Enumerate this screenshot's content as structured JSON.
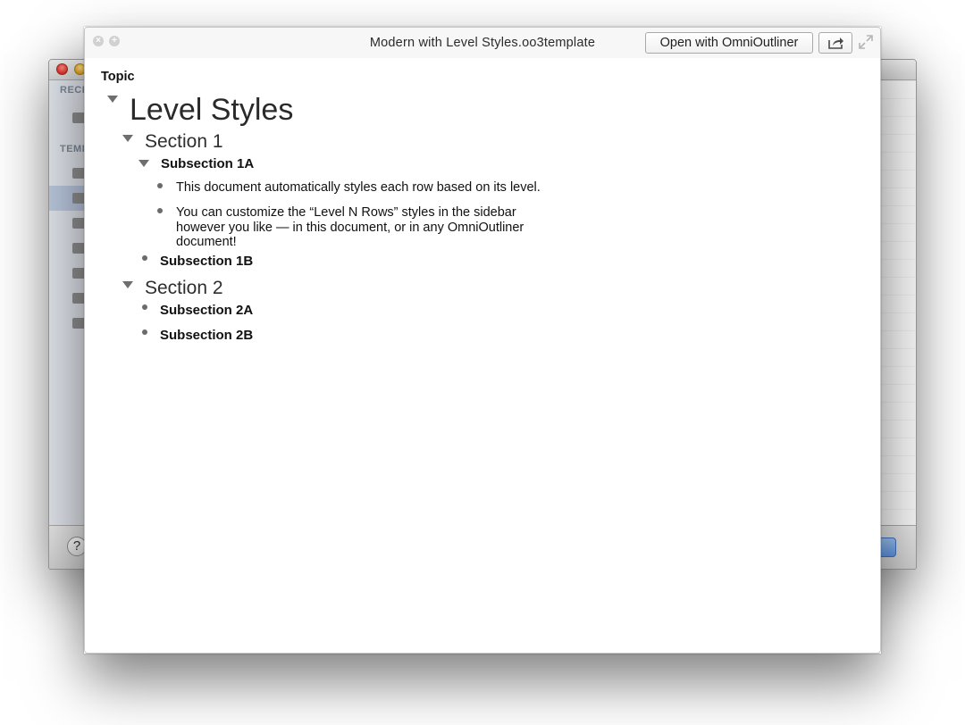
{
  "background_window": {
    "sidebar": {
      "recent_header": "RECE",
      "templates_header": "TEMP"
    },
    "help_label": "?"
  },
  "quicklook": {
    "title": "Modern with Level Styles.oo3template",
    "open_button_label": "Open with OmniOutliner",
    "close_glyph": "×",
    "zoom_glyph": "+"
  },
  "outline": {
    "column_header": "Topic",
    "level1_title": "Level Styles",
    "section1": {
      "title": "Section 1",
      "subsection_a": {
        "title": "Subsection 1A",
        "items": [
          "This document automatically styles each row based on its level.",
          "You can customize the “Level N Rows” styles in the sidebar however you like — in this document, or in any OmniOutliner document!"
        ]
      },
      "subsection_b": "Subsection 1B"
    },
    "section2": {
      "title": "Section 2",
      "subsection_a": "Subsection 2A",
      "subsection_b": "Subsection 2B"
    }
  },
  "icons": {
    "close": "close-icon",
    "zoom": "zoom-icon",
    "share": "share-icon",
    "expand": "fullscreen-icon",
    "disclosure": "disclosure-triangle-icon",
    "bullet": "bullet-icon",
    "folder": "folder-icon"
  }
}
